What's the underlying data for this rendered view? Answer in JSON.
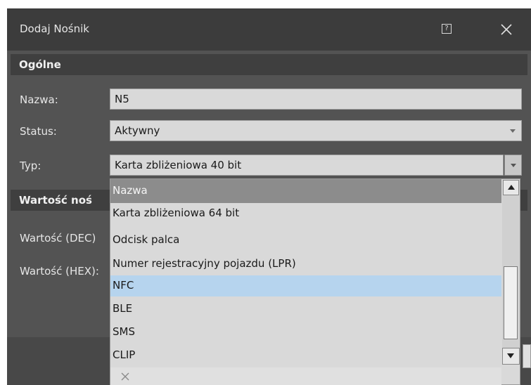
{
  "window": {
    "title": "Dodaj Nośnik",
    "help_icon": "help-icon",
    "close_icon": "close-icon"
  },
  "general": {
    "header": "Ogólne",
    "name_label": "Nazwa:",
    "name_value": "N5",
    "status_label": "Status:",
    "status_value": "Aktywny",
    "type_label": "Typ:",
    "type_value": "Karta zbliżeniowa 40 bit"
  },
  "value_section": {
    "header": "Wartość noś",
    "dec_label": "Wartość (DEC)",
    "hex_label": "Wartość (HEX):"
  },
  "dropdown": {
    "header": "Nazwa",
    "items": [
      "Karta zbliżeniowa 64 bit",
      "Odcisk palca",
      "Numer rejestracyjny pojazdu (LPR)",
      "NFC",
      "BLE",
      "SMS",
      "CLIP"
    ],
    "selected": "NFC",
    "clear_icon": "clear-icon"
  },
  "colors": {
    "dialog_bg": "#535353",
    "titlebar_bg": "#3c3c3c",
    "section_bg": "#3f3f3f",
    "field_bg": "#d9d9d9",
    "selected_bg": "#b6d4ee"
  }
}
